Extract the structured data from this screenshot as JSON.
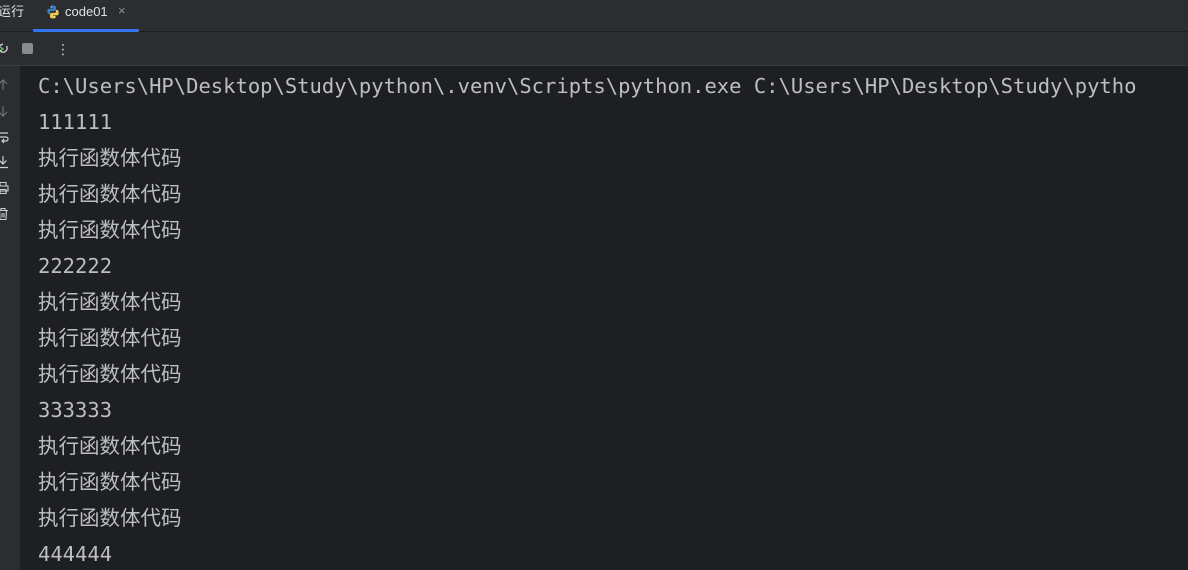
{
  "run_panel": {
    "label": "运行",
    "tab": {
      "label": "code01",
      "icon": "python-file-icon",
      "close_icon": "close-icon",
      "close_glyph": "×"
    }
  },
  "toolbar": {
    "rerun_icon": "rerun-icon",
    "stop_icon": "stop-icon",
    "more_icon": "more-vertical-icon",
    "more_glyph": "⋮"
  },
  "sidebar": {
    "icons": [
      "scroll-up-icon",
      "scroll-down-icon",
      "soft-wrap-icon",
      "scroll-to-end-icon",
      "print-icon",
      "clear-all-icon"
    ]
  },
  "console": {
    "lines": [
      "C:\\Users\\HP\\Desktop\\Study\\python\\.venv\\Scripts\\python.exe C:\\Users\\HP\\Desktop\\Study\\pytho",
      "111111",
      "执行函数体代码",
      "执行函数体代码",
      "执行函数体代码",
      "222222",
      "执行函数体代码",
      "执行函数体代码",
      "执行函数体代码",
      "333333",
      "执行函数体代码",
      "执行函数体代码",
      "执行函数体代码",
      "444444"
    ]
  },
  "colors": {
    "background": "#1e1f22",
    "panel": "#2b2d30",
    "text": "#bcbec4",
    "accent": "#3574f0",
    "python_blue": "#3d7ab8",
    "python_yellow": "#f2c94c"
  }
}
